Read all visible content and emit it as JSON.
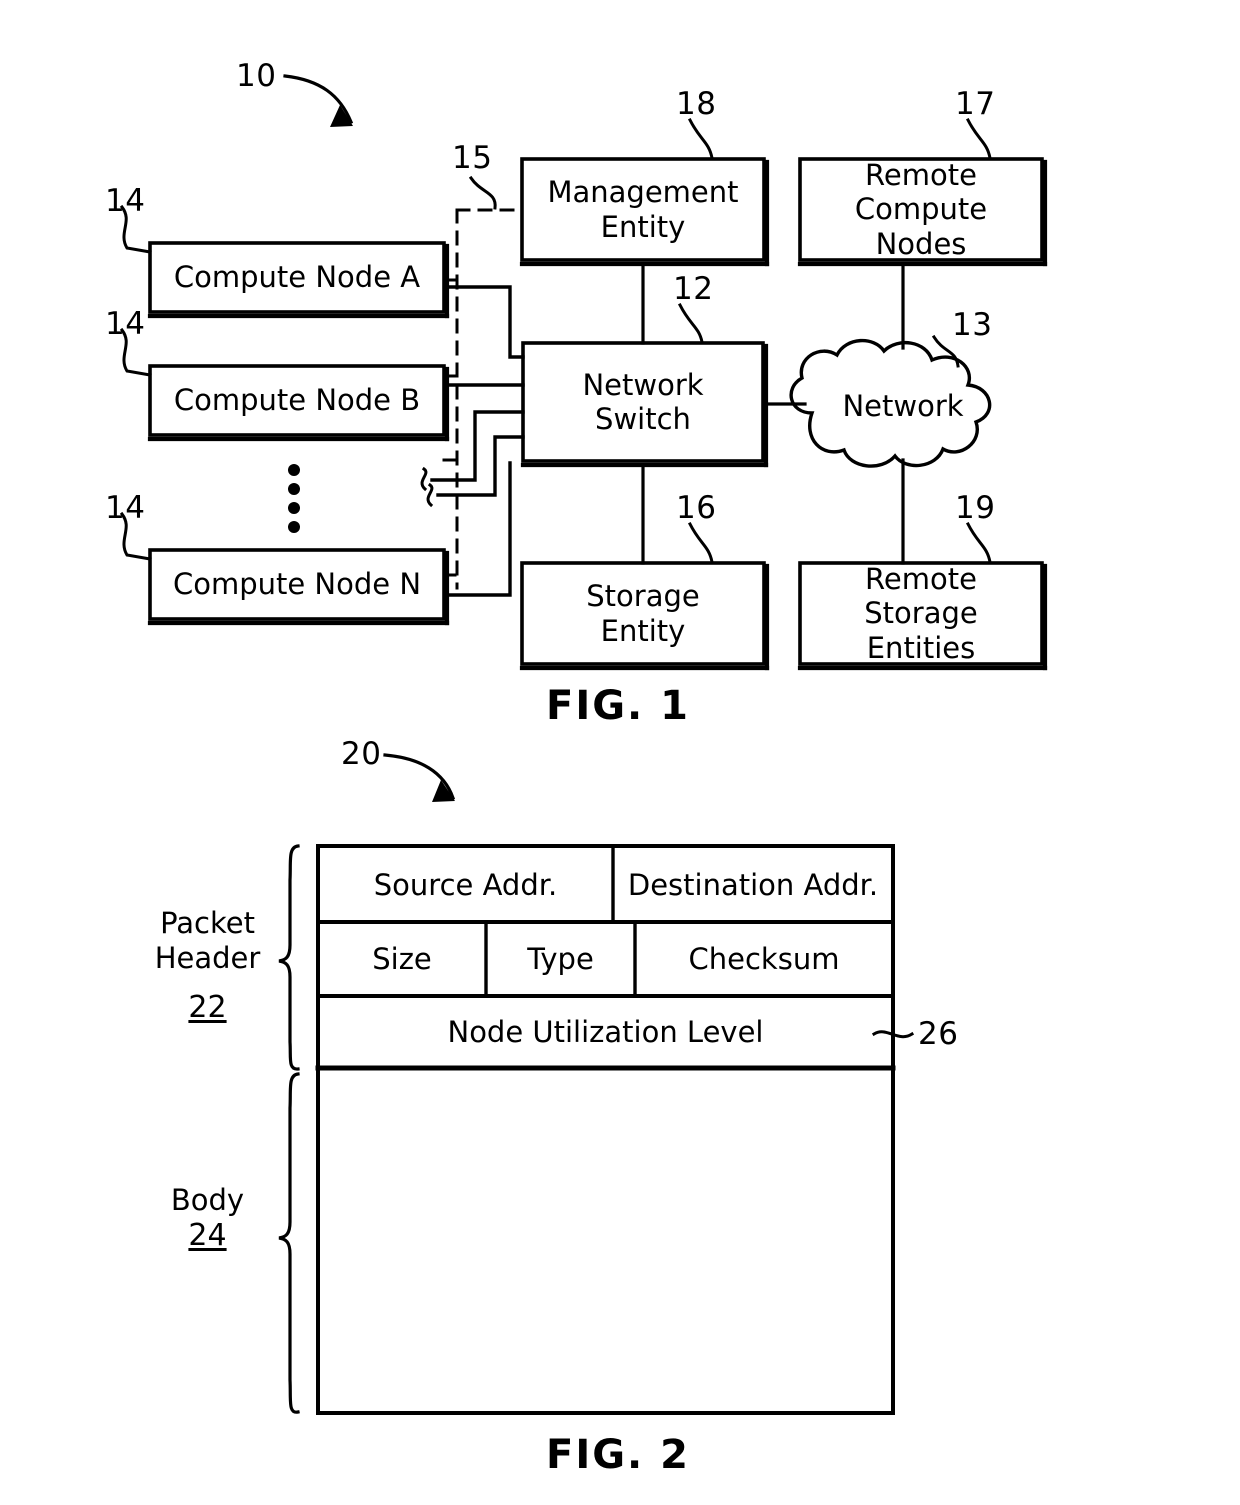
{
  "figure1": {
    "caption": "FIG. 1",
    "system_ref": "10",
    "nodes": [
      {
        "label": "Compute Node A",
        "ref": "14"
      },
      {
        "label": "Compute Node B",
        "ref": "14"
      },
      {
        "label": "Compute Node N",
        "ref": "14"
      }
    ],
    "blocks": {
      "management_entity": {
        "label": "Management\nEntity",
        "ref": "18"
      },
      "network_switch": {
        "label": "Network\nSwitch",
        "ref": "12"
      },
      "storage_entity": {
        "label": "Storage\nEntity",
        "ref": "16"
      },
      "remote_compute_nodes": {
        "label": "Remote\nCompute\nNodes",
        "ref": "17"
      },
      "network_cloud": {
        "label": "Network",
        "ref": "13"
      },
      "remote_storage_entities": {
        "label": "Remote\nStorage\nEntities",
        "ref": "19"
      }
    },
    "management_link_ref": "15",
    "ellipsis": "vertical-dots"
  },
  "figure2": {
    "caption": "FIG. 2",
    "packet_ref": "20",
    "brackets": [
      {
        "name": "Packet\nHeader",
        "ref": "22"
      },
      {
        "name": "Body",
        "ref": "24"
      }
    ],
    "rows": [
      {
        "cells": [
          {
            "label": "Source Addr."
          },
          {
            "label": "Destination Addr."
          }
        ]
      },
      {
        "cells": [
          {
            "label": "Size"
          },
          {
            "label": "Type"
          },
          {
            "label": "Checksum"
          }
        ]
      },
      {
        "cells": [
          {
            "label": "Node Utilization Level"
          }
        ]
      },
      {
        "cells": [
          {
            "label": ""
          }
        ]
      }
    ],
    "node_utilization_ref": "26"
  },
  "style": {
    "ink": "#000000",
    "paper": "#ffffff"
  }
}
